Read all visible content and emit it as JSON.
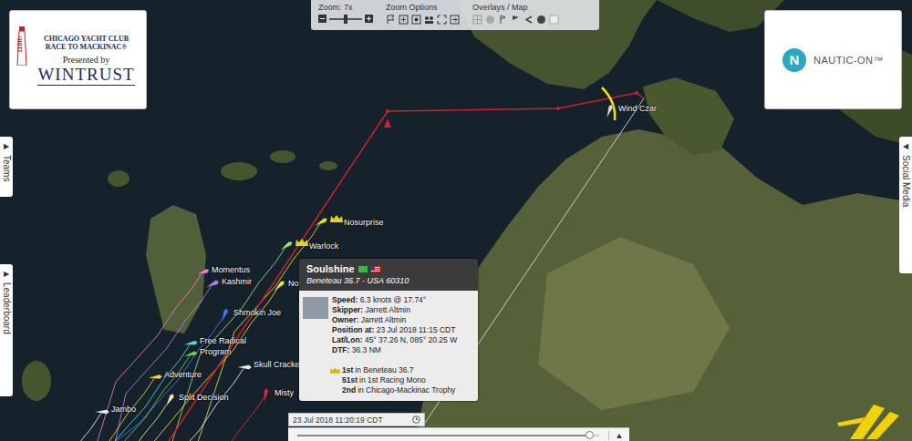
{
  "logo": {
    "badge": "110th",
    "club": "CHICAGO YACHT CLUB",
    "race": "RACE TO MACKINAC®",
    "presented": "Presented by",
    "sponsor": "WINTRUST"
  },
  "toolbar": {
    "zoom_label": "Zoom: 7x",
    "zoom_level": 0.5,
    "zoom_options": "Zoom Options",
    "overlays": "Overlays / Map"
  },
  "partner_logo": {
    "mark": "N",
    "name": "NAUTIC-ON™"
  },
  "left_tabs": [
    {
      "arrow": "▶",
      "label": "Teams"
    },
    {
      "arrow": "▶",
      "label": "Leaderboard"
    }
  ],
  "right_tabs": [
    {
      "arrow": "◀",
      "label": "Social Media"
    }
  ],
  "boats": [
    {
      "name": "Wind Czar",
      "color": "#d8d8d8",
      "leader": false
    },
    {
      "name": "Nosurprise",
      "color": "#e8e23a",
      "leader": true
    },
    {
      "name": "Warlock",
      "color": "#9be07a",
      "leader": true
    },
    {
      "name": "Momentus",
      "color": "#f07ad8",
      "leader": false
    },
    {
      "name": "Kashmir",
      "color": "#b77ef0",
      "leader": false
    },
    {
      "name": "No",
      "color": "#f2e24a",
      "leader": false
    },
    {
      "name": "Shmokin Joe",
      "color": "#3b7cf0",
      "leader": false
    },
    {
      "name": "Free Radical",
      "color": "#4fd8e8",
      "leader": false
    },
    {
      "name": "Program",
      "color": "#6cd060",
      "leader": false
    },
    {
      "name": "Skull Cracker",
      "color": "#f4f4f4",
      "leader": false
    },
    {
      "name": "Adventure",
      "color": "#e8d84a",
      "leader": false
    },
    {
      "name": "Split Decision",
      "color": "#f4eea0",
      "leader": false
    },
    {
      "name": "Misty",
      "color": "#e0283a",
      "leader": false
    },
    {
      "name": "Jambo",
      "color": "#f0f0f0",
      "leader": false
    }
  ],
  "popup": {
    "name": "Soulshine",
    "subtitle": "Beneteau 36.7 - USA 60310",
    "rows": [
      {
        "label": "Speed:",
        "value": "6.3 knots @ 17.74°"
      },
      {
        "label": "Skipper:",
        "value": "Jarrett Altmin"
      },
      {
        "label": "Owner:",
        "value": "Jarrett Altmin"
      },
      {
        "label": "Position at:",
        "value": "23 Jul 2018 11:15 CDT"
      },
      {
        "label": "Lat/Lon:",
        "value": "45° 37.26 N, 085° 20.25 W"
      },
      {
        "label": "DTF:",
        "value": "36.3 NM"
      }
    ],
    "rankings": [
      {
        "rank": "1st",
        "text": "in Beneteau 36.7",
        "leader": true
      },
      {
        "rank": "51st",
        "text": "in 1st Racing Mono",
        "leader": false
      },
      {
        "rank": "2nd",
        "text": "in Chicago-Mackinac Trophy",
        "leader": false
      }
    ]
  },
  "timeline": {
    "time": "23 Jul 2018 11:20:19 CDT",
    "level": 0.97,
    "play": "▲"
  }
}
